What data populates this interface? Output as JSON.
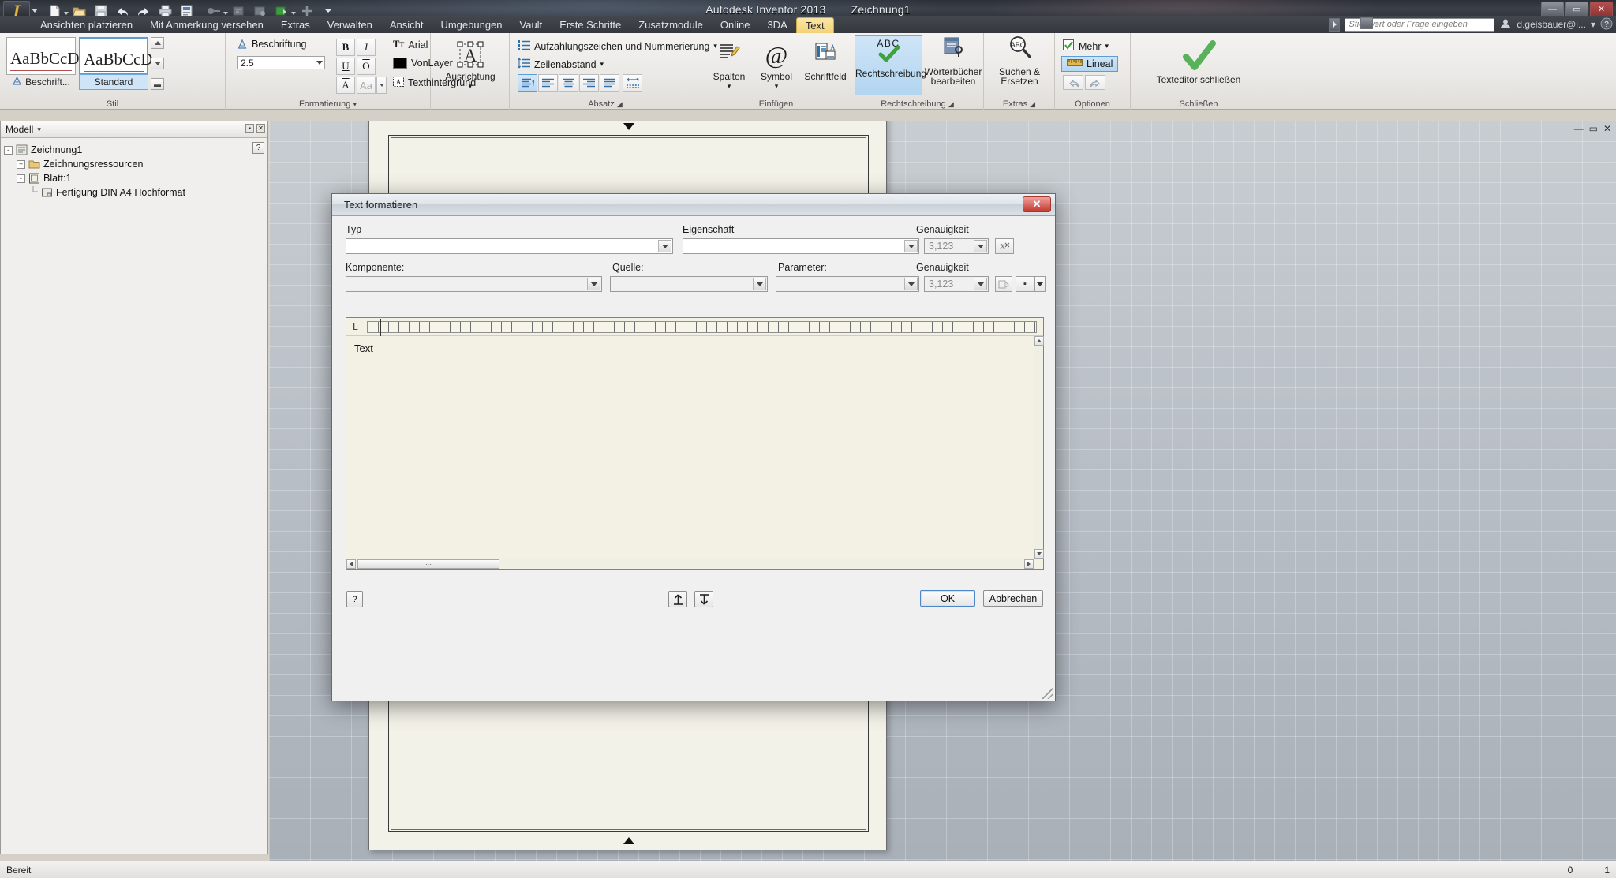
{
  "window": {
    "app_title": "Autodesk Inventor 2013",
    "document_title": "Zeichnung1",
    "minimize": "—",
    "maximize": "▭",
    "close": "✕"
  },
  "quick_access": {
    "icons": [
      "new-file-icon",
      "open-folder-icon",
      "save-icon",
      "undo-icon",
      "redo-icon",
      "print-icon",
      "print-preview-icon",
      "return-icon",
      "update-icon",
      "material-icon",
      "color-icon",
      "add-icon",
      "customize-caret-icon"
    ]
  },
  "search": {
    "placeholder": "Stichwort oder Frage eingeben",
    "arrow_icon": "search-arrow-icon"
  },
  "account": {
    "signin_icon": "signin-icon",
    "user": "d.geisbauer@i...",
    "caret": "▾",
    "help_icon": "help-icon"
  },
  "ribbon_tabs": [
    {
      "label": "Ansichten platzieren",
      "active": false
    },
    {
      "label": "Mit Anmerkung versehen",
      "active": false
    },
    {
      "label": "Extras",
      "active": false
    },
    {
      "label": "Verwalten",
      "active": false
    },
    {
      "label": "Ansicht",
      "active": false
    },
    {
      "label": "Umgebungen",
      "active": false
    },
    {
      "label": "Vault",
      "active": false
    },
    {
      "label": "Erste Schritte",
      "active": false
    },
    {
      "label": "Zusatzmodule",
      "active": false
    },
    {
      "label": "Online",
      "active": false
    },
    {
      "label": "3DA",
      "active": false
    },
    {
      "label": "Text",
      "active": true
    }
  ],
  "ribbon": {
    "panel_stil": {
      "title": "Stil",
      "preview_text": "AaBbCcD",
      "style_default_label": "Beschrift...",
      "style_selected_label": "Standard",
      "style_default_icon": "text-style-icon",
      "spin_up": "▲",
      "spin_down": "▼",
      "more_btn": "▭"
    },
    "panel_formatierung": {
      "title": "Formatierung",
      "dropdown_caret": "▾",
      "style_name": "Beschriftung",
      "style_icon": "annotation-style-icon",
      "size_value": "2.5",
      "bold": "B",
      "italic": "I",
      "underline": "U",
      "overline": "O",
      "strike": "A",
      "case": "Aa",
      "font_name": "Arial",
      "font_icon": "font-icon",
      "color_value": "VonLayer",
      "color_swatch": "#000000",
      "background_label": "Texthintergrund",
      "background_icon": "text-background-icon"
    },
    "panel_ausrichtung": {
      "button_label": "Ausrichtung",
      "glyph": "A",
      "caret": "▾"
    },
    "panel_absatz": {
      "title": "Absatz",
      "bullets_label": "Aufzählungszeichen und Nummerierung",
      "bullets_icon": "bullet-list-icon",
      "bullets_caret": "▾",
      "linespacing_label": "Zeilenabstand",
      "linespacing_icon": "line-spacing-icon",
      "linespacing_caret": "▾",
      "align_buttons": [
        "align-justify-mark-icon",
        "align-left-icon",
        "align-center-icon",
        "align-right-icon",
        "align-justify-icon",
        "indent-icon"
      ],
      "dialog_launcher": "◢"
    },
    "panel_einfuegen": {
      "title": "Einfügen",
      "items": [
        {
          "label": "Spalten",
          "icon": "columns-icon",
          "caret": "▾"
        },
        {
          "label": "Symbol",
          "icon": "at-symbol-icon",
          "caret": "▾"
        },
        {
          "label": "Schriftfeld",
          "icon": "title-block-icon",
          "caret": ""
        }
      ]
    },
    "panel_rechtschreibung": {
      "title": "Rechtschreibung",
      "items": [
        {
          "label": "Rechtschreibung",
          "icon": "abc-check-icon",
          "selected": true
        },
        {
          "label": "Wörterbücher bearbeiten",
          "icon": "dictionary-icon",
          "selected": false
        }
      ],
      "dialog_launcher": "◢"
    },
    "panel_extras": {
      "title": "Extras",
      "items": [
        {
          "label": "Suchen & Ersetzen",
          "icon": "find-replace-icon"
        }
      ],
      "dialog_launcher": "◢"
    },
    "panel_optionen": {
      "title": "Optionen",
      "more_label": "Mehr",
      "more_icon": "checkbox-checked-icon",
      "more_caret": "▾",
      "ruler_label": "Lineal",
      "ruler_icon": "ruler-icon",
      "undo_icon": "undo-small-icon",
      "redo_icon": "redo-small-icon"
    },
    "panel_schliessen": {
      "title": "Schließen",
      "label": "Texteditor schließen",
      "icon": "green-check-icon"
    }
  },
  "browser": {
    "header": "Modell",
    "header_caret": "▾",
    "help_btn": "?",
    "pin_btn": "▪",
    "close_btn": "✕",
    "tree": [
      {
        "label": "Zeichnung1",
        "icon": "drawing-icon",
        "depth": 0,
        "expander": "-"
      },
      {
        "label": "Zeichnungsressourcen",
        "icon": "folder-icon",
        "depth": 1,
        "expander": "+"
      },
      {
        "label": "Blatt:1",
        "icon": "sheet-icon",
        "depth": 1,
        "expander": "-"
      },
      {
        "label": "Fertigung DIN A4 Hochformat",
        "icon": "border-icon",
        "depth": 2,
        "expander": ""
      }
    ]
  },
  "dialog": {
    "title": "Text formatieren",
    "close_label": "✕",
    "labels": {
      "typ": "Typ",
      "eigenschaft": "Eigenschaft",
      "genauigkeit1": "Genauigkeit",
      "komponente": "Komponente:",
      "quelle": "Quelle:",
      "parameter": "Parameter:",
      "genauigkeit2": "Genauigkeit"
    },
    "values": {
      "typ": "",
      "eigenschaft": "",
      "genauigkeit1": "3,123",
      "komponente": "",
      "quelle": "",
      "parameter": "",
      "genauigkeit2": "3,123"
    },
    "icon_buttons": {
      "insert_property": "insert-property-icon",
      "insert_parameter": "insert-parameter-icon",
      "symbol_pick": "symbol-pick-icon",
      "symbol_caret": "▾"
    },
    "editor": {
      "tabstop_glyph": "L",
      "content": "Text"
    },
    "footer": {
      "help": "?",
      "move_up_icon": "move-up-icon",
      "move_down_icon": "move-down-icon",
      "ok": "OK",
      "cancel": "Abbrechen"
    }
  },
  "statusbar": {
    "message": "Bereit",
    "value_left": "0",
    "value_right": "1"
  }
}
